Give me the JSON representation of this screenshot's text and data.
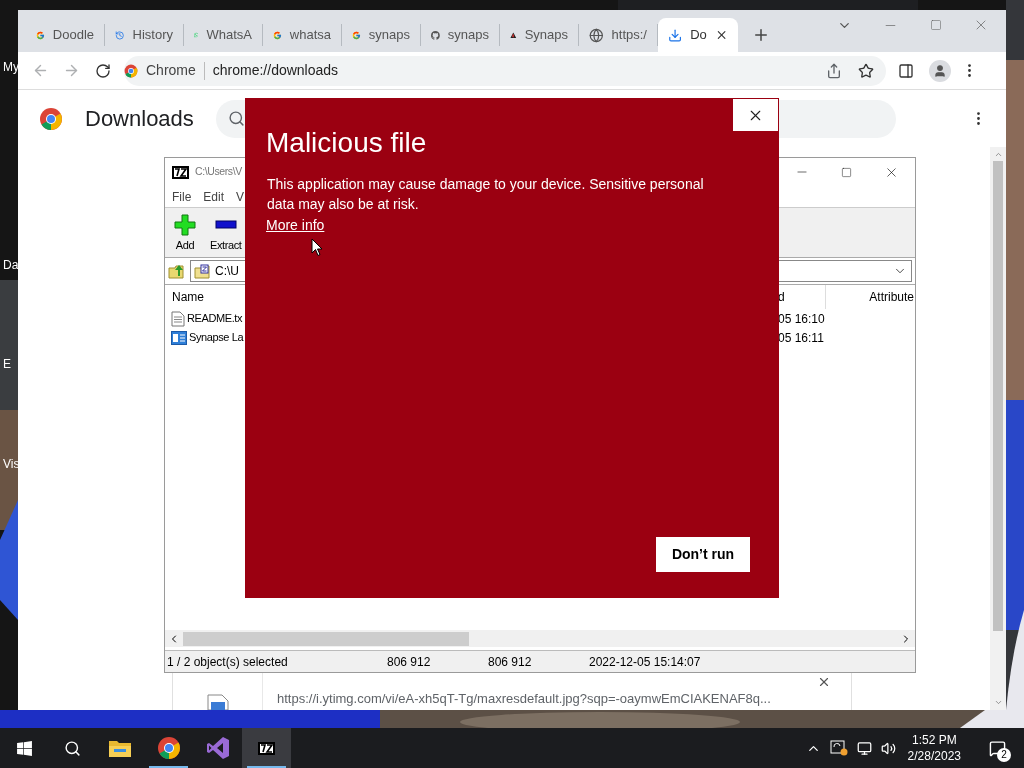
{
  "desktop": {
    "icon_labels": [
      "My",
      "Da",
      "E",
      "Vis"
    ]
  },
  "browser": {
    "tabs": [
      {
        "title": "Doodle",
        "kind": "google",
        "selected": false
      },
      {
        "title": "History",
        "kind": "history",
        "selected": false
      },
      {
        "title": "WhatsA",
        "kind": "whatsapp",
        "selected": false
      },
      {
        "title": "whatsa",
        "kind": "google",
        "selected": false
      },
      {
        "title": "synaps",
        "kind": "google",
        "selected": false
      },
      {
        "title": "synaps",
        "kind": "github",
        "selected": false
      },
      {
        "title": "Synaps",
        "kind": "synapse",
        "selected": false
      },
      {
        "title": "https:/",
        "kind": "globe",
        "selected": false
      },
      {
        "title": "Do",
        "kind": "download",
        "selected": true
      }
    ],
    "omnibox": {
      "chip": "Chrome",
      "url": "chrome://downloads"
    },
    "page": {
      "title": "Downloads",
      "download_item": {
        "url": "https://i.ytimg.com/vi/eA-xh5qT-Tg/maxresdefault.jpg?sqp=-oaymwEmCIAKENAF8q..."
      }
    }
  },
  "archive_window": {
    "title": "C:\\Users\\V",
    "menu": [
      "File",
      "Edit",
      "V"
    ],
    "toolbar": [
      {
        "label": "Add",
        "kind": "add"
      },
      {
        "label": "Extract",
        "kind": "extract"
      }
    ],
    "path": "C:\\U",
    "columns": [
      "Name",
      "d",
      "Attribute"
    ],
    "rows": [
      {
        "name": "README.tx",
        "modified": "05 16:10",
        "kind": "text"
      },
      {
        "name": "Synapse La",
        "modified": "05 16:11",
        "kind": "app"
      }
    ],
    "status": [
      "1 / 2 object(s) selected",
      "806 912",
      "806 912",
      "2022-12-05 15:14:07"
    ]
  },
  "dialog": {
    "title": "Malicious file",
    "message": "This application may cause damage to your device. Sensitive personal data may also be at risk.",
    "link": "More info",
    "button": "Don’t run"
  },
  "taskbar": {
    "apps": [
      {
        "kind": "explorer",
        "running": false,
        "selected": false
      },
      {
        "kind": "chrome",
        "running": true,
        "selected": false
      },
      {
        "kind": "vs",
        "running": false,
        "selected": false
      },
      {
        "kind": "sevenzip",
        "running": true,
        "selected": true
      }
    ],
    "time": "1:52 PM",
    "date": "2/28/2023",
    "notifications": "2"
  }
}
